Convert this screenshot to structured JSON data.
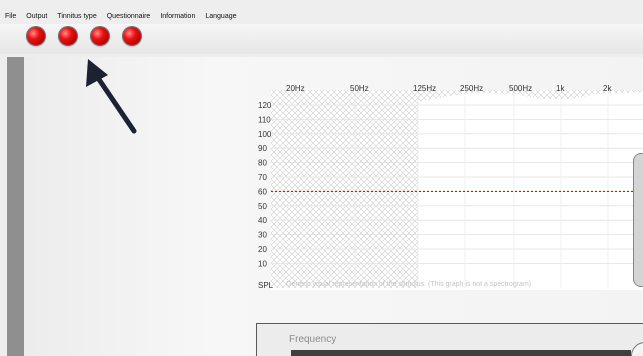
{
  "menu": {
    "items": [
      "File",
      "Output",
      "Tinnitus type",
      "Questionnaire",
      "Information",
      "Language"
    ]
  },
  "toolbar": {
    "indicators": [
      "red",
      "red",
      "red",
      "red"
    ]
  },
  "chart": {
    "freq_labels": [
      "20Hz",
      "50Hz",
      "125Hz",
      "250Hz",
      "500Hz",
      "1k",
      "2k"
    ],
    "spl_ticks": [
      "120",
      "110",
      "100",
      "90",
      "80",
      "70",
      "60",
      "50",
      "40",
      "30",
      "20",
      "10"
    ],
    "spl_unit": "SPL",
    "caption": "Generic visual representation of the stimulus. (This graph is not a spectrogram)",
    "threshold_level": 60,
    "threshold_color": "#b00000"
  },
  "controls": {
    "frequency_label": "Frequency"
  }
}
